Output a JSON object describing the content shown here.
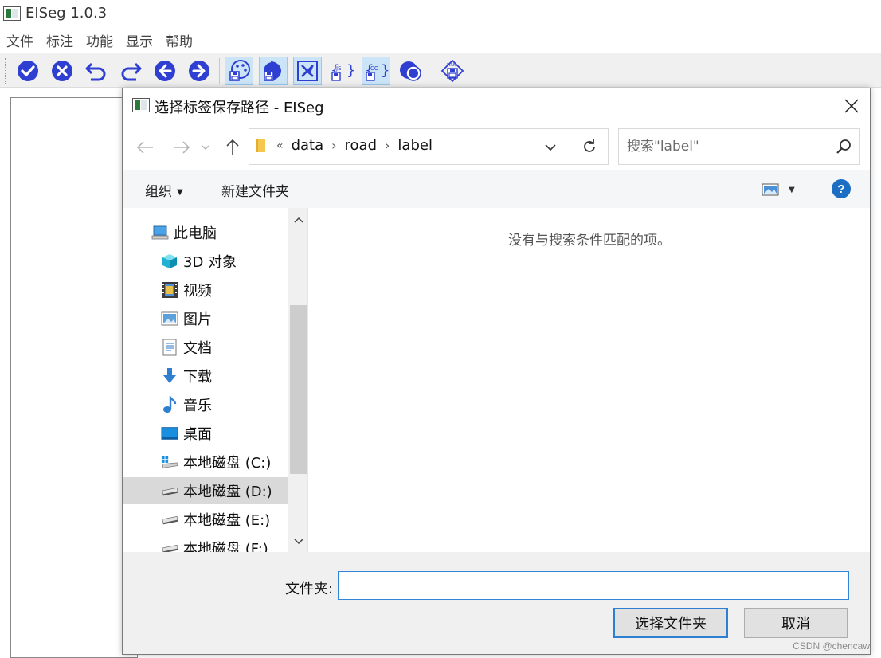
{
  "app": {
    "title": "EISeg 1.0.3",
    "menu": [
      "文件",
      "标注",
      "功能",
      "显示",
      "帮助"
    ],
    "toolbar": [
      {
        "name": "finish-icon",
        "active": false
      },
      {
        "name": "clear-icon",
        "active": false
      },
      {
        "name": "undo-icon",
        "active": false
      },
      {
        "name": "redo-icon",
        "active": false
      },
      {
        "name": "prev-image-icon",
        "active": false
      },
      {
        "name": "next-image-icon",
        "active": false
      },
      {
        "name": "save-pseudo-color-icon",
        "active": true
      },
      {
        "name": "save-mask-icon",
        "active": true
      },
      {
        "name": "save-cutout-icon",
        "active": true
      },
      {
        "name": "save-json-icon",
        "active": false
      },
      {
        "name": "save-coco-icon",
        "active": true
      },
      {
        "name": "use-threshold-icon",
        "active": false
      },
      {
        "name": "save-mrk-icon",
        "active": false
      }
    ],
    "accent_color": "#2e3fd1"
  },
  "dialog": {
    "title": "选择标签保存路径 - EISeg",
    "breadcrumbs": [
      "data",
      "road",
      "label"
    ],
    "search_placeholder": "搜索\"label\"",
    "organize_label": "组织",
    "new_folder_label": "新建文件夹",
    "tree": [
      {
        "label": "此电脑",
        "icon": "this-pc-icon",
        "level": 0,
        "selected": false
      },
      {
        "label": "3D 对象",
        "icon": "3d-objects-icon",
        "level": 1,
        "selected": false
      },
      {
        "label": "视频",
        "icon": "videos-icon",
        "level": 1,
        "selected": false
      },
      {
        "label": "图片",
        "icon": "pictures-icon",
        "level": 1,
        "selected": false
      },
      {
        "label": "文档",
        "icon": "documents-icon",
        "level": 1,
        "selected": false
      },
      {
        "label": "下载",
        "icon": "downloads-icon",
        "level": 1,
        "selected": false
      },
      {
        "label": "音乐",
        "icon": "music-icon",
        "level": 1,
        "selected": false
      },
      {
        "label": "桌面",
        "icon": "desktop-icon",
        "level": 1,
        "selected": false
      },
      {
        "label": "本地磁盘 (C:)",
        "icon": "windows-drive-icon",
        "level": 1,
        "selected": false
      },
      {
        "label": "本地磁盘 (D:)",
        "icon": "drive-icon",
        "level": 1,
        "selected": true
      },
      {
        "label": "本地磁盘 (E:)",
        "icon": "drive-icon",
        "level": 1,
        "selected": false
      },
      {
        "label": "本地磁盘 (F:)",
        "icon": "drive-icon",
        "level": 1,
        "selected": false
      }
    ],
    "empty_message": "没有与搜索条件匹配的项。",
    "folder_label": "文件夹:",
    "folder_value": "",
    "select_button": "选择文件夹",
    "cancel_button": "取消"
  },
  "watermark": "CSDN @chencaw"
}
